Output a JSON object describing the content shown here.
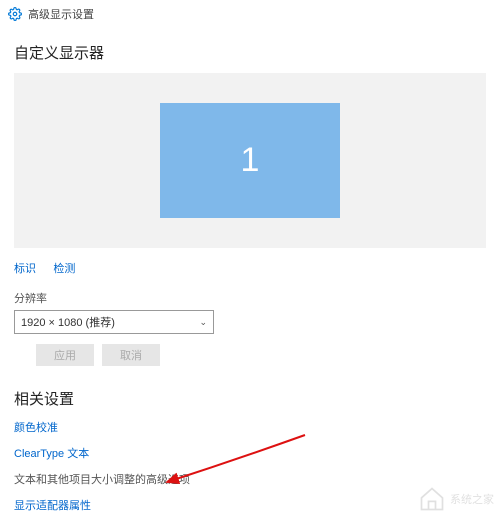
{
  "titlebar": {
    "title": "高级显示设置"
  },
  "sections": {
    "customize_title": "自定义显示器",
    "related_title": "相关设置"
  },
  "monitor": {
    "number": "1"
  },
  "links": {
    "identify": "标识",
    "detect": "检测",
    "color_calibration": "颜色校准",
    "cleartype": "ClearType 文本",
    "adapter_props": "显示适配器属性"
  },
  "resolution": {
    "label": "分辨率",
    "value": "1920 × 1080 (推荐)"
  },
  "buttons": {
    "apply": "应用",
    "cancel": "取消"
  },
  "text": {
    "advanced_sizing": "文本和其他项目大小调整的高级选项"
  },
  "watermark": {
    "text": "系统之家"
  }
}
